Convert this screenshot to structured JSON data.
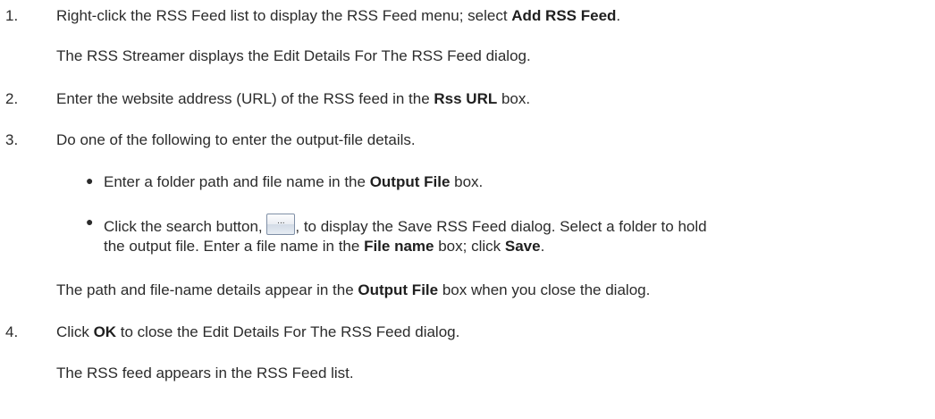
{
  "steps": [
    {
      "number": "1.",
      "text_parts": [
        "Right-click the RSS Feed list to display the RSS Feed menu; select ",
        "Add RSS Feed",
        "."
      ],
      "note": "The RSS Streamer displays the Edit Details For The RSS Feed dialog."
    },
    {
      "number": "2.",
      "text_parts": [
        "Enter the website address (URL) of the RSS feed in the ",
        "Rss URL",
        " box."
      ]
    },
    {
      "number": "3.",
      "text": "Do one of the following to enter the output-file details.",
      "bullets": [
        {
          "parts": [
            "Enter a folder path and file name in the ",
            "Output File",
            " box."
          ]
        },
        {
          "pre_icon": "Click the search button, ",
          "post_icon": ", to display the Save RSS Feed dialog. Select a folder to hold",
          "line2_parts": [
            "the output file. Enter a file name in the ",
            "File name",
            " box; click ",
            "Save",
            "."
          ],
          "icon_label": "...",
          "icon_name": "browse-button-icon"
        }
      ],
      "note_parts": [
        "The path and file-name details appear in the ",
        "Output File",
        " box when you close the dialog."
      ]
    },
    {
      "number": "4.",
      "text_parts": [
        "Click ",
        "OK",
        " to close the Edit Details For The RSS Feed dialog."
      ],
      "note": "The RSS feed appears in the RSS Feed list."
    }
  ]
}
